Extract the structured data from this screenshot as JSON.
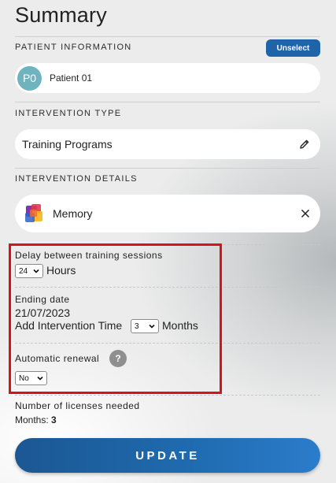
{
  "title": "Summary",
  "patient": {
    "section_label": "PATIENT INFORMATION",
    "unselect_label": "Unselect",
    "avatar_initials": "P0",
    "name": "Patient 01"
  },
  "intervention_type": {
    "section_label": "INTERVENTION TYPE",
    "value": "Training Programs",
    "icon": "pencil-icon"
  },
  "intervention_details": {
    "section_label": "INTERVENTION DETAILS",
    "name": "Memory",
    "icon": "memory-logo",
    "remove_icon": "close-icon"
  },
  "delay": {
    "label": "Delay between training sessions",
    "selected": "24",
    "unit": "Hours"
  },
  "ending": {
    "label": "Ending date",
    "date": "21/07/2023",
    "add_time_label": "Add Intervention Time",
    "selected_months": "3",
    "unit": "Months"
  },
  "renewal": {
    "label": "Automatic renewal",
    "help": "?",
    "selected": "No"
  },
  "licenses": {
    "label": "Number of licenses needed",
    "months_label": "Months:",
    "months_value": "3"
  },
  "update_label": "UPDATE",
  "colors": {
    "primary": "#1f63a8",
    "highlight": "#d8121a",
    "avatar": "#6fb3bf",
    "help": "#8f8f8f"
  }
}
